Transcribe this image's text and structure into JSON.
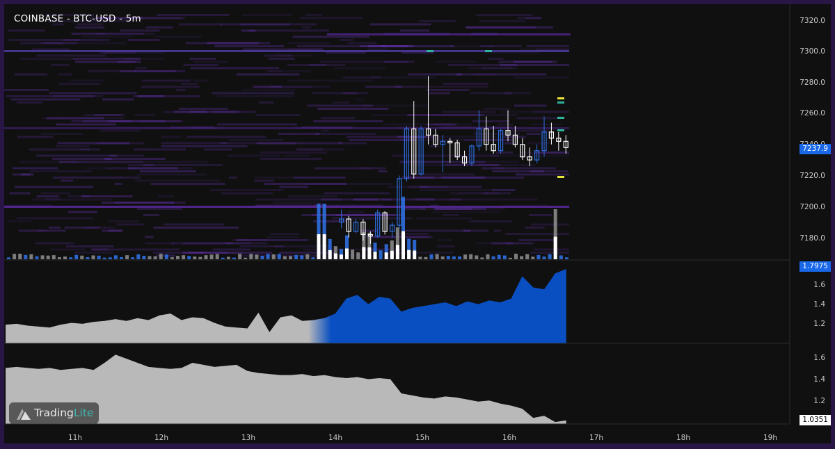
{
  "chart": {
    "title": "COINBASE - BTC-USD - 5m",
    "price_axis_ticks": [
      "7320.0",
      "7300.0",
      "7280.0",
      "7260.0",
      "7240.0",
      "7220.0",
      "7200.0",
      "7180.0"
    ],
    "current_price": "7237.9",
    "indicator1_axis_ticks": [
      "1.6",
      "1.4",
      "1.2"
    ],
    "indicator1_value": "1.7975",
    "indicator2_axis_ticks": [
      "1.6",
      "1.4",
      "1.2"
    ],
    "indicator2_value": "1.0351",
    "time_axis_labels": [
      "11h",
      "12h",
      "13h",
      "14h",
      "15h",
      "16h",
      "17h",
      "18h",
      "19h"
    ],
    "watermark": {
      "text_main": "Trading",
      "text_accent": "Lite"
    },
    "colors": {
      "up": "#2f6fe0",
      "down": "#ffffff",
      "area_blue": "#0a4fc2",
      "area_gray": "#b9b9b9",
      "heat": "#7a3bd6"
    }
  },
  "chart_data": [
    {
      "type": "candlestick",
      "title": "COINBASE - BTC-USD - 5m",
      "x_unit": "hour",
      "ylim": [
        7170,
        7325
      ],
      "candles_from_hour": 14.0,
      "candles_step_hours": 0.0833,
      "ohlc": [
        [
          7190,
          7198,
          7186,
          7192
        ],
        [
          7192,
          7194,
          7180,
          7184
        ],
        [
          7184,
          7192,
          7183,
          7190
        ],
        [
          7190,
          7192,
          7178,
          7182
        ],
        [
          7182,
          7184,
          7176,
          7181
        ],
        [
          7181,
          7198,
          7180,
          7196
        ],
        [
          7196,
          7197,
          7182,
          7184
        ],
        [
          7184,
          7190,
          7180,
          7188
        ],
        [
          7188,
          7220,
          7186,
          7218
        ],
        [
          7218,
          7252,
          7216,
          7250
        ],
        [
          7250,
          7268,
          7218,
          7221
        ],
        [
          7221,
          7252,
          7220,
          7250
        ],
        [
          7250,
          7284,
          7240,
          7246
        ],
        [
          7246,
          7250,
          7238,
          7240
        ],
        [
          7240,
          7246,
          7222,
          7242
        ],
        [
          7242,
          7244,
          7228,
          7241
        ],
        [
          7241,
          7243,
          7230,
          7232
        ],
        [
          7232,
          7236,
          7226,
          7228
        ],
        [
          7228,
          7240,
          7226,
          7239
        ],
        [
          7239,
          7262,
          7236,
          7250
        ],
        [
          7250,
          7258,
          7236,
          7240
        ],
        [
          7240,
          7252,
          7234,
          7236
        ],
        [
          7236,
          7250,
          7234,
          7249
        ],
        [
          7249,
          7262,
          7242,
          7246
        ],
        [
          7246,
          7252,
          7238,
          7240
        ],
        [
          7240,
          7244,
          7230,
          7232
        ],
        [
          7232,
          7238,
          7226,
          7230
        ],
        [
          7230,
          7240,
          7228,
          7236
        ],
        [
          7236,
          7258,
          7232,
          7248
        ],
        [
          7248,
          7254,
          7240,
          7244
        ],
        [
          7244,
          7248,
          7236,
          7242
        ],
        [
          7242,
          7246,
          7234,
          7238
        ]
      ]
    },
    {
      "type": "area",
      "title": "",
      "ylim": [
        1.0,
        1.85
      ],
      "x_range_hours": [
        10.2,
        16.65
      ],
      "values": [
        1.2,
        1.21,
        1.19,
        1.18,
        1.17,
        1.2,
        1.22,
        1.21,
        1.23,
        1.24,
        1.26,
        1.24,
        1.27,
        1.25,
        1.3,
        1.32,
        1.25,
        1.28,
        1.27,
        1.22,
        1.18,
        1.17,
        1.16,
        1.33,
        1.12,
        1.28,
        1.3,
        1.24,
        1.25,
        1.27,
        1.32,
        1.48,
        1.52,
        1.42,
        1.5,
        1.48,
        1.34,
        1.38,
        1.4,
        1.42,
        1.44,
        1.4,
        1.45,
        1.42,
        1.46,
        1.44,
        1.48,
        1.72,
        1.6,
        1.58,
        1.75,
        1.7975
      ]
    },
    {
      "type": "area",
      "title": "",
      "ylim": [
        1.0,
        1.75
      ],
      "x_range_hours": [
        10.2,
        16.65
      ],
      "values": [
        1.55,
        1.56,
        1.55,
        1.54,
        1.55,
        1.53,
        1.54,
        1.55,
        1.53,
        1.6,
        1.68,
        1.64,
        1.6,
        1.56,
        1.55,
        1.54,
        1.55,
        1.6,
        1.58,
        1.56,
        1.57,
        1.58,
        1.52,
        1.5,
        1.49,
        1.48,
        1.48,
        1.49,
        1.47,
        1.48,
        1.46,
        1.45,
        1.46,
        1.44,
        1.45,
        1.44,
        1.3,
        1.28,
        1.26,
        1.25,
        1.27,
        1.26,
        1.24,
        1.22,
        1.23,
        1.2,
        1.18,
        1.15,
        1.06,
        1.08,
        1.02,
        1.0351
      ]
    }
  ]
}
